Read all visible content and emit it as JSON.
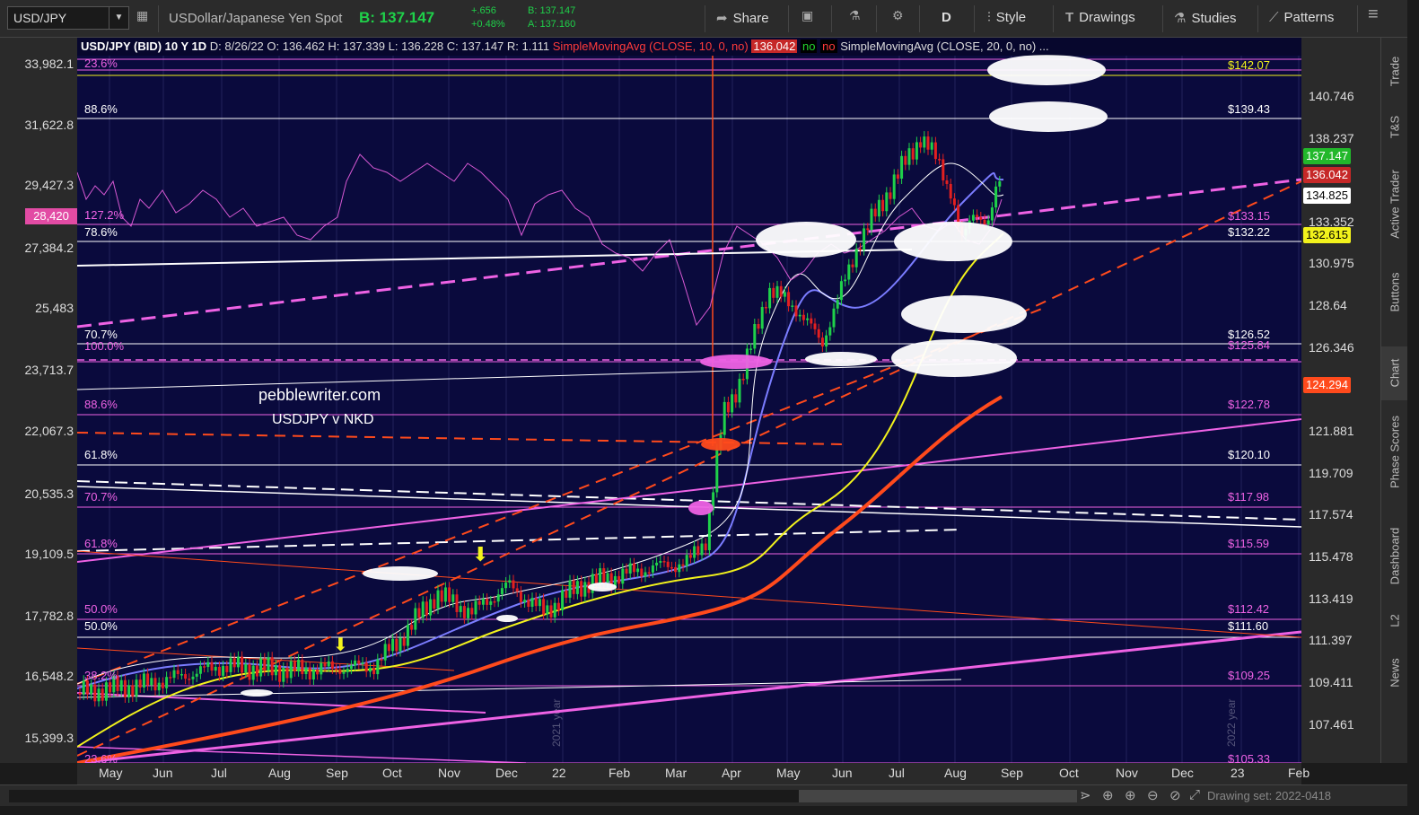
{
  "toolbar": {
    "symbol": "USD/JPY",
    "description": "USDollar/Japanese Yen Spot",
    "bid": "B: 137.147",
    "change": "+.656",
    "change_pct": "+0.48%",
    "bid_small": "B: 137.147",
    "ask_small": "A: 137.160",
    "share_label": "Share",
    "aggregation": "D",
    "style_label": "Style",
    "drawings_label": "Drawings",
    "studies_label": "Studies",
    "patterns_label": "Patterns"
  },
  "chart_header": {
    "title": "USD/JPY (BID) 10 Y 1D",
    "date": "D: 8/26/22",
    "open": "O: 136.462",
    "high": "H: 137.339",
    "low": "L: 136.228",
    "close": "C: 137.147",
    "range": "R: 1.111",
    "sma1": "SimpleMovingAvg (CLOSE, 10, 0, no)",
    "sma1_value": "136.042",
    "no1": "no",
    "no2": "no",
    "sma2": "SimpleMovingAvg (CLOSE, 20, 0, no) ..."
  },
  "annotations": {
    "watermark": "pebblewriter.com",
    "subtitle": "USDJPY v NKD",
    "year_2021": "2021 year",
    "year_2022": "2022 year"
  },
  "fib_labels_left": [
    "23.6%",
    "88.6%",
    "127.2%",
    "78.6%",
    "70.7%",
    "100.0%",
    "88.6%",
    "61.8%",
    "70.7%",
    "61.8%",
    "50.0%",
    "50.0%",
    "38.2%",
    "23.6%"
  ],
  "fib_labels_right": [
    "$142.07",
    "$139.43",
    "$133.15",
    "$132.22",
    "$126.52",
    "$125.84",
    "$122.78",
    "$120.10",
    "$117.98",
    "$115.59",
    "$112.42",
    "$111.60",
    "$109.25",
    "$105.33"
  ],
  "left_axis": {
    "ticks": [
      "33,982.1",
      "31,622.8",
      "29,427.3",
      "27,384.2",
      "25,483",
      "23,713.7",
      "22,067.3",
      "20,535.3",
      "19,109.5",
      "17,782.8",
      "16,548.2",
      "15,399.3"
    ],
    "tag": "28,420"
  },
  "right_axis": {
    "ticks": [
      "140.746",
      "138.237",
      "133.352",
      "130.975",
      "128.64",
      "126.346",
      "121.881",
      "119.709",
      "117.574",
      "115.478",
      "113.419",
      "111.397",
      "109.411",
      "107.461"
    ],
    "tags": [
      {
        "label": "137.147",
        "bg": "#22b82b",
        "fg": "#ffffff"
      },
      {
        "label": "136.042",
        "bg": "#c62828",
        "fg": "#ffffff"
      },
      {
        "label": "134.825",
        "bg": "#ffffff",
        "fg": "#000000"
      },
      {
        "label": "132.615",
        "bg": "#f2f21c",
        "fg": "#000000"
      },
      {
        "label": "124.294",
        "bg": "#ff4a1c",
        "fg": "#ffffff"
      }
    ]
  },
  "time_axis": [
    "May",
    "Jun",
    "Jul",
    "Aug",
    "Sep",
    "Oct",
    "Nov",
    "Dec",
    "22",
    "Feb",
    "Mar",
    "Apr",
    "May",
    "Jun",
    "Jul",
    "Aug",
    "Sep",
    "Oct",
    "Nov",
    "Dec",
    "23",
    "Feb"
  ],
  "side_tabs": [
    "Trade",
    "T&S",
    "Active Trader",
    "Buttons",
    "Chart",
    "Phase Scores",
    "Dashboard",
    "L2",
    "News"
  ],
  "bottom": {
    "drawing_set": "Drawing set: 2022-0418"
  },
  "colors": {
    "chart_bg": "#0a0a3d",
    "magenta": "#ee62e4",
    "orange": "#ff4a1c",
    "yellow": "#f2f21c",
    "blue": "#7a7cff",
    "up_candle": "#1fd14a",
    "down_candle": "#e32020"
  }
}
